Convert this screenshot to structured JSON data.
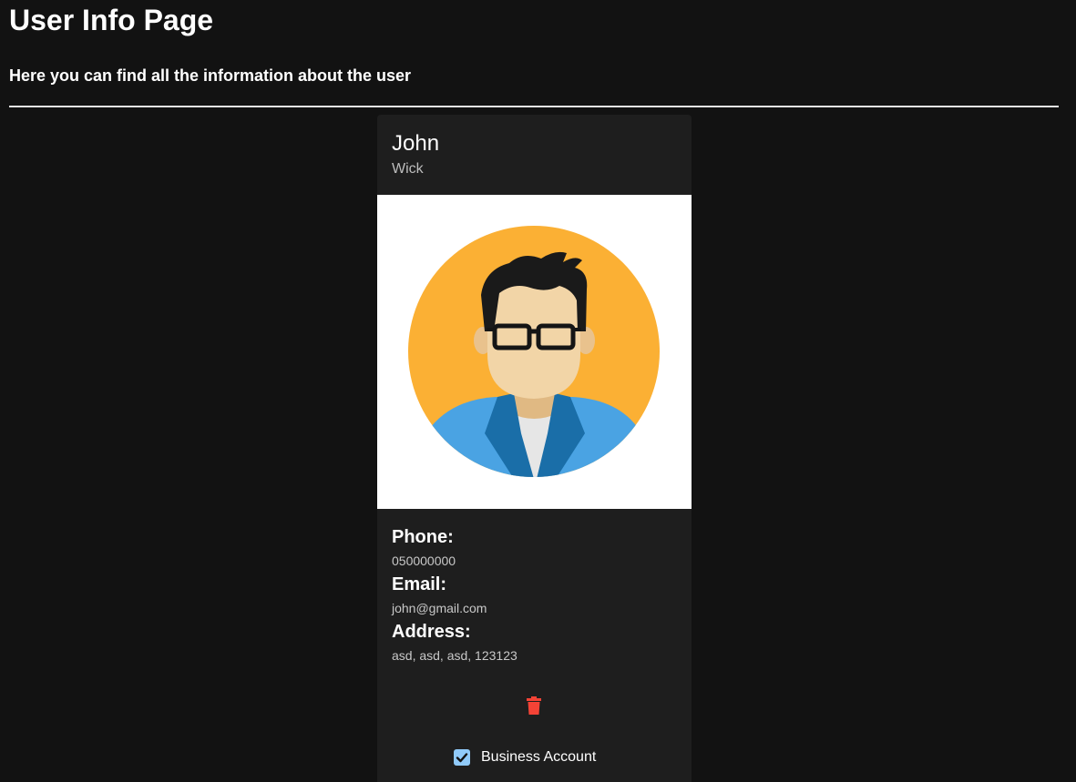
{
  "page": {
    "title": "User Info Page",
    "subtitle": "Here you can find all the information about the user"
  },
  "user": {
    "first_name": "John",
    "last_name": "Wick",
    "avatar_icon": "user-avatar-illustration",
    "fields": [
      {
        "label": "Phone:",
        "value": "050000000"
      },
      {
        "label": "Email:",
        "value": "john@gmail.com"
      },
      {
        "label": "Address:",
        "value": "asd, asd, asd, 123123"
      }
    ]
  },
  "actions": {
    "delete_icon": "trash-icon",
    "delete_color": "#f44336",
    "business_account": {
      "label": "Business Account",
      "checked": true,
      "color": "#90caf9"
    }
  },
  "colors": {
    "background": "#121212",
    "card": "#1e1e1e",
    "avatar_background": "#fbb034"
  }
}
